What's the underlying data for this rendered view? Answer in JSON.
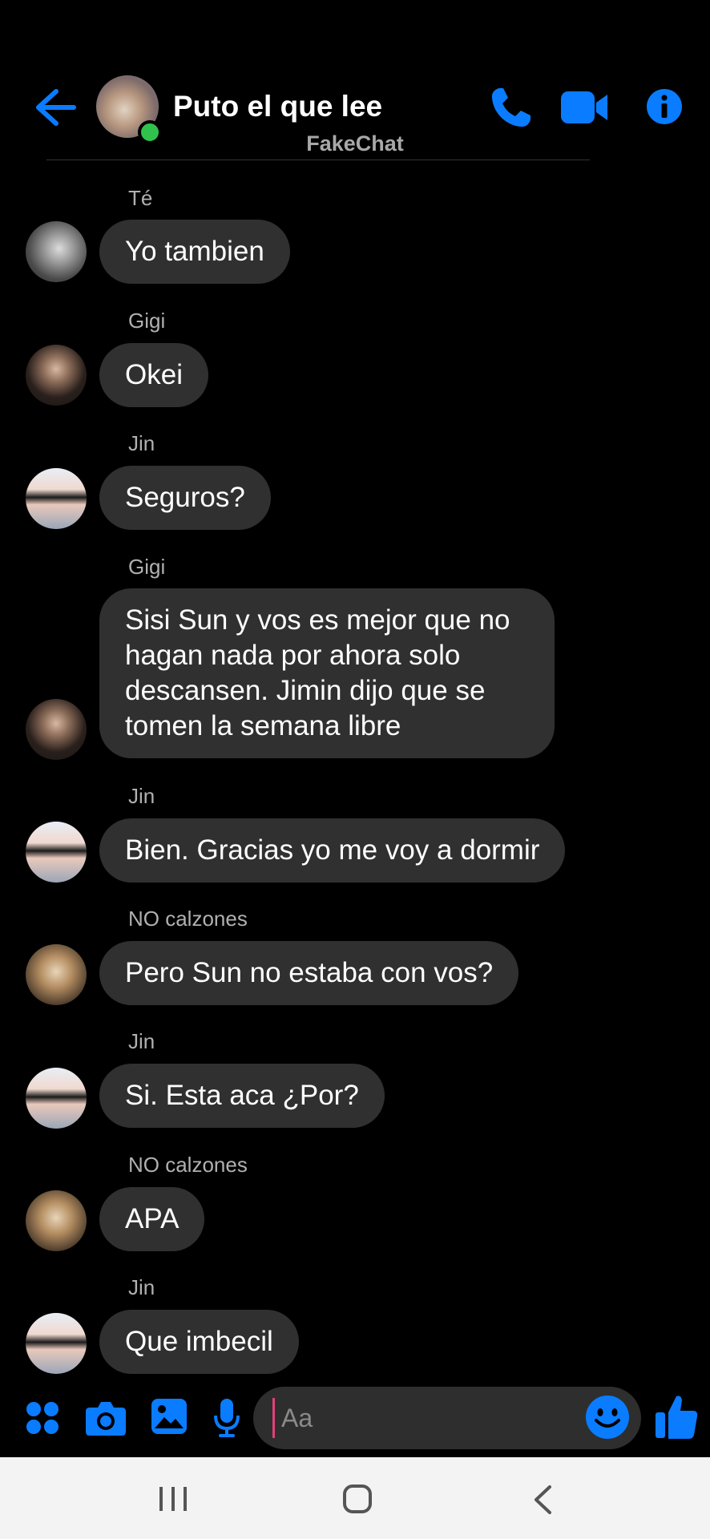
{
  "header": {
    "title": "Puto el que lee",
    "subtitle": "FakeChat",
    "status": "online",
    "icons": [
      "back-arrow-icon",
      "phone-icon",
      "video-camera-icon",
      "info-icon"
    ]
  },
  "messages": [
    {
      "sender": "Té",
      "text": "Yo tambien"
    },
    {
      "sender": "Gigi",
      "text": "Okei"
    },
    {
      "sender": "Jin",
      "text": "Seguros?"
    },
    {
      "sender": "Gigi",
      "text": "Sisi Sun y vos es mejor que no hagan nada por ahora solo descansen. Jimin dijo que se tomen la semana libre"
    },
    {
      "sender": "Jin",
      "text": "Bien. Gracias yo me voy a dormir"
    },
    {
      "sender": "NO calzones",
      "text": "Pero Sun no estaba con vos?"
    },
    {
      "sender": "Jin",
      "text": "Si. Esta aca ¿Por?"
    },
    {
      "sender": "NO calzones",
      "text": "APA"
    },
    {
      "sender": "Jin",
      "text": "Que imbecil"
    }
  ],
  "composer": {
    "placeholder": "Aa",
    "icons": [
      "apps-grid-icon",
      "camera-icon",
      "gallery-icon",
      "microphone-icon",
      "emoji-icon",
      "thumbs-up-icon"
    ]
  },
  "colors": {
    "accent": "#0a7cff",
    "bubble": "#303030",
    "background": "#000000",
    "online": "#31c24d"
  }
}
